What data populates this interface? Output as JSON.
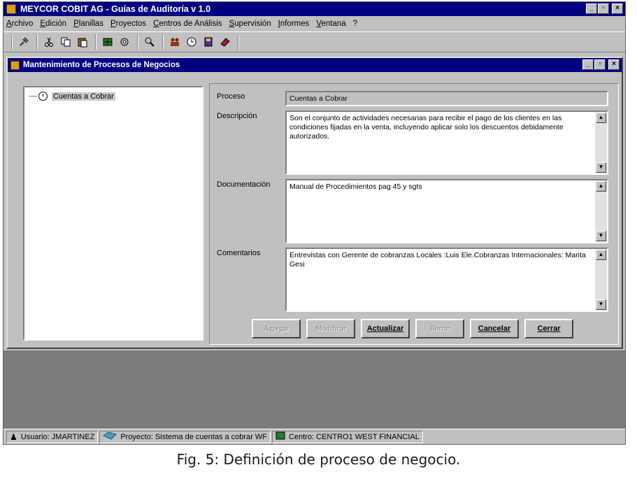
{
  "app": {
    "title": "MEYCOR COBIT AG - Guías de Auditoría v 1.0",
    "menu": [
      "Archivo",
      "Edición",
      "Planillas",
      "Proyectos",
      "Centros de Análisis",
      "Supervisión",
      "Informes",
      "Ventana",
      "?"
    ]
  },
  "toolbar": {
    "icons": [
      "pin-icon",
      "cut-icon",
      "copy-icon",
      "paste-icon",
      "grid-icon",
      "gear-icon",
      "search-icon",
      "people-icon",
      "clock-icon",
      "book-icon",
      "eraser-icon"
    ]
  },
  "child_window": {
    "title": "Mantenimiento de Procesos de Negocios"
  },
  "tree": {
    "node_label": "Cuentas a Cobrar"
  },
  "form": {
    "proceso_label": "Proceso",
    "proceso_value": "Cuentas a Cobrar",
    "descripcion_label": "Descripción",
    "descripcion_value": "Son el conjunto de actividades necesarias para recibir el pago de los clientes en las condiciones fijadas en la venta, incluyendo aplicar solo los descuentos debidamente autorizados.",
    "documentacion_label": "Documentación",
    "documentacion_value": "Manual de Procedimientos pag 45 y sgts",
    "comentarios_label": "Comentarios",
    "comentarios_value": "Entrevistas con Gerente de cobranzas Locales :Luis Ele.Cobranzas Internacionales: Marita Gesi"
  },
  "buttons": {
    "agregar": "Agregar",
    "modificar": "Modificar",
    "actualizar": "Actualizar",
    "borrar": "Borrar",
    "cancelar": "Cancelar",
    "cerrar": "Cerrar"
  },
  "status": {
    "usuario": "Usuario: JMARTINEZ",
    "proyecto": "Proyecto: Sistema de cuentas a cobrar WF",
    "centro": "Centro: CENTRO1 WEST FINANCIAL"
  },
  "caption": "Fig. 5:  Definición de proceso de negocio."
}
